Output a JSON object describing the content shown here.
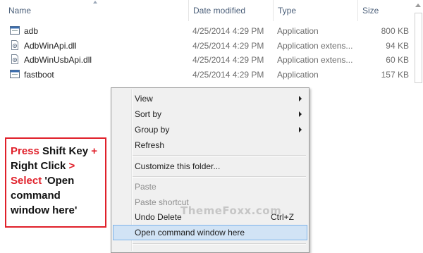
{
  "columns": {
    "name": "Name",
    "date": "Date modified",
    "type": "Type",
    "size": "Size"
  },
  "files": [
    {
      "name": "adb",
      "date": "4/25/2014 4:29 PM",
      "type": "Application",
      "size": "800 KB",
      "icon": "exe-icon"
    },
    {
      "name": "AdbWinApi.dll",
      "date": "4/25/2014 4:29 PM",
      "type": "Application extens...",
      "size": "94 KB",
      "icon": "dll-icon"
    },
    {
      "name": "AdbWinUsbApi.dll",
      "date": "4/25/2014 4:29 PM",
      "type": "Application extens...",
      "size": "60 KB",
      "icon": "dll-icon"
    },
    {
      "name": "fastboot",
      "date": "4/25/2014 4:29 PM",
      "type": "Application",
      "size": "157 KB",
      "icon": "exe-icon"
    }
  ],
  "context_menu": {
    "view": "View",
    "sort_by": "Sort by",
    "group_by": "Group by",
    "refresh": "Refresh",
    "customize": "Customize this folder...",
    "paste": "Paste",
    "paste_shortcut": "Paste shortcut",
    "undo_delete": "Undo Delete",
    "undo_shortcut": "Ctrl+Z",
    "open_cmd": "Open command window here",
    "highlight_color": "#d1e3f5"
  },
  "annotation": {
    "press": "Press",
    "shift_key": " Shift Key ",
    "plus": "+",
    "right_click": "Right Click ",
    "gt": ">",
    "select": "Select",
    "open_text": " 'Open command window here'",
    "accent_color": "#e0202a"
  },
  "watermark": "ThemeFoxx.com"
}
